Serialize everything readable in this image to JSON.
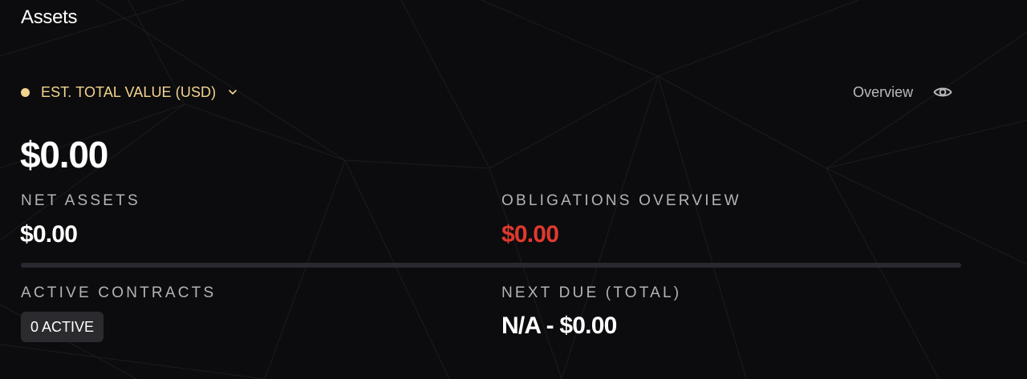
{
  "page": {
    "title": "Assets"
  },
  "selector": {
    "label": "EST. TOTAL VALUE (USD)",
    "dot_color": "#f3d48f",
    "icon": "chevron-down-icon"
  },
  "overview": {
    "label": "Overview",
    "icon": "eye-icon"
  },
  "total_value": "$0.00",
  "net_assets": {
    "label": "NET ASSETS",
    "value": "$0.00"
  },
  "obligations": {
    "label": "OBLIGATIONS OVERVIEW",
    "value": "$0.00",
    "value_color": "#e0392e"
  },
  "active_contracts": {
    "label": "ACTIVE CONTRACTS",
    "badge": "0 ACTIVE"
  },
  "next_due": {
    "label": "NEXT DUE (TOTAL)",
    "value": "N/A - $0.00"
  }
}
